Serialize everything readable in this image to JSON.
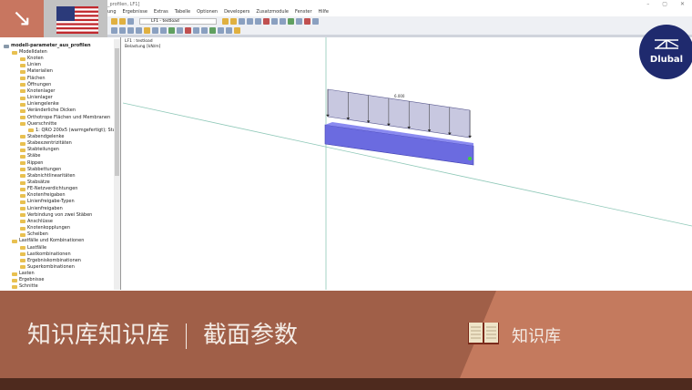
{
  "window": {
    "title": "_profilen, LF1]",
    "controls": [
      "–",
      "▢",
      "✕"
    ]
  },
  "menu": [
    "ung",
    "Ergebnisse",
    "Extras",
    "Tabelle",
    "Optionen",
    "Developers",
    "Zusatzmodule",
    "Fenster",
    "Hilfe"
  ],
  "toolbar": {
    "loadcase_combo": "LF1 - testload"
  },
  "tree": {
    "root": "modell-parameter_aus_profilen",
    "items": [
      {
        "label": "Modelldaten",
        "lvl": 1
      },
      {
        "label": "Knoten",
        "lvl": 2
      },
      {
        "label": "Linien",
        "lvl": 2
      },
      {
        "label": "Materialien",
        "lvl": 2
      },
      {
        "label": "Flächen",
        "lvl": 2
      },
      {
        "label": "Öffnungen",
        "lvl": 2
      },
      {
        "label": "Knotenlager",
        "lvl": 2
      },
      {
        "label": "Linienlager",
        "lvl": 2
      },
      {
        "label": "Liniengelenke",
        "lvl": 2
      },
      {
        "label": "Veränderliche Dicken",
        "lvl": 2
      },
      {
        "label": "Orthotrope Flächen und Membranen",
        "lvl": 2
      },
      {
        "label": "Querschnitte",
        "lvl": 2
      },
      {
        "label": "1: QRO 200x5 (warmgefertigt); Stahl",
        "lvl": 3
      },
      {
        "label": "Stabendgelenke",
        "lvl": 2
      },
      {
        "label": "Stabexzentrizitäten",
        "lvl": 2
      },
      {
        "label": "Stabteilungen",
        "lvl": 2
      },
      {
        "label": "Stäbe",
        "lvl": 2
      },
      {
        "label": "Rippen",
        "lvl": 2
      },
      {
        "label": "Stabbettungen",
        "lvl": 2
      },
      {
        "label": "Stabnichtlinearitäten",
        "lvl": 2
      },
      {
        "label": "Stabsätze",
        "lvl": 2
      },
      {
        "label": "FE-Netzverdichtungen",
        "lvl": 2
      },
      {
        "label": "Knotenfreigaben",
        "lvl": 2
      },
      {
        "label": "Linienfreigabe-Typen",
        "lvl": 2
      },
      {
        "label": "Linienfreigaben",
        "lvl": 2
      },
      {
        "label": "Verbindung von zwei Stäben",
        "lvl": 2
      },
      {
        "label": "Anschlüsse",
        "lvl": 2
      },
      {
        "label": "Knotenkopplungen",
        "lvl": 2
      },
      {
        "label": "Scheiben",
        "lvl": 2
      },
      {
        "label": "Lastfälle und Kombinationen",
        "lvl": 1
      },
      {
        "label": "Lastfälle",
        "lvl": 2
      },
      {
        "label": "Lastkombinationen",
        "lvl": 2
      },
      {
        "label": "Ergebniskombinationen",
        "lvl": 2
      },
      {
        "label": "Superkombinationen",
        "lvl": 2
      },
      {
        "label": "Lasten",
        "lvl": 1
      },
      {
        "label": "Ergebnisse",
        "lvl": 1
      },
      {
        "label": "Schnitte",
        "lvl": 1
      }
    ]
  },
  "viewport": {
    "line1": "LF1 : testload",
    "line2": "Belastung [kN/m]",
    "load_value": "6.000"
  },
  "brand": {
    "dlubal": "Dlubal"
  },
  "banner": {
    "title_left": "知识库知识库",
    "title_right": "截面参数",
    "kb_label": "知识库"
  },
  "colors": {
    "banner": "#a05f48",
    "banner_accent": "#c47a5e",
    "dlubal": "#1f2a6e"
  }
}
